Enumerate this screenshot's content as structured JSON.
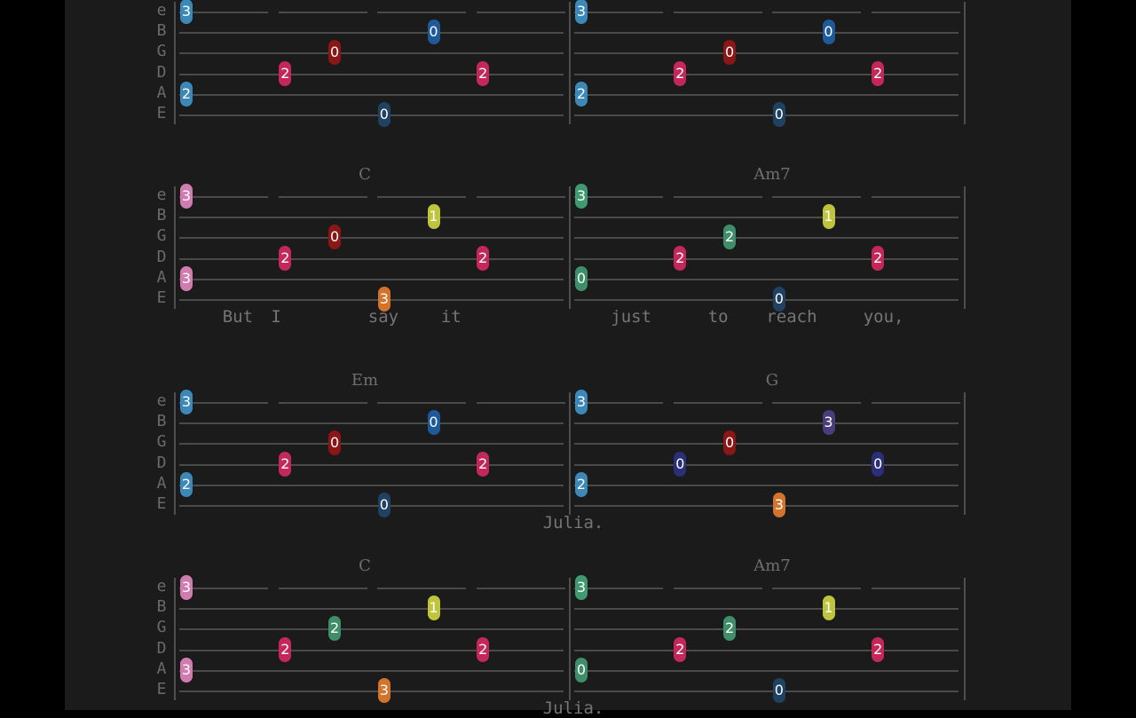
{
  "strings": [
    "e",
    "B",
    "G",
    "D",
    "A",
    "E"
  ],
  "colors": {
    "fret0_blue": "#1e5a9a",
    "fret0_navy": "#204262",
    "fret0_indigo": "#2a2f78",
    "fret0_red": "#8a1616",
    "fret0_green": "#3f8e6a",
    "fret1": "#bec53c",
    "fret2_red": "#c4285a",
    "fret2_teal": "#3f8e6a",
    "fret2_blue": "#3c88b8",
    "fret3_pink": "#d07cb0",
    "fret3_green": "#3f9a70",
    "fret3_blue": "#3c88b8",
    "fret3_orange": "#d2742c",
    "fret3_purple": "#4c3c7c"
  },
  "systems": [
    {
      "chords": [
        "",
        ""
      ],
      "lyrics": [],
      "measures": [
        [
          {
            "s": "e",
            "f": "3",
            "pos": 0,
            "c": "fret3_blue"
          },
          {
            "s": "A",
            "f": "2",
            "pos": 0,
            "c": "fret2_blue"
          },
          {
            "s": "D",
            "f": "2",
            "pos": 2,
            "c": "fret2_red"
          },
          {
            "s": "G",
            "f": "0",
            "pos": 3,
            "c": "fret0_red"
          },
          {
            "s": "E",
            "f": "0",
            "pos": 4,
            "c": "fret0_navy"
          },
          {
            "s": "B",
            "f": "0",
            "pos": 5,
            "c": "fret0_blue"
          },
          {
            "s": "D",
            "f": "2",
            "pos": 6,
            "c": "fret2_red"
          }
        ],
        [
          {
            "s": "e",
            "f": "3",
            "pos": 0,
            "c": "fret3_blue"
          },
          {
            "s": "A",
            "f": "2",
            "pos": 0,
            "c": "fret2_blue"
          },
          {
            "s": "D",
            "f": "2",
            "pos": 2,
            "c": "fret2_red"
          },
          {
            "s": "G",
            "f": "0",
            "pos": 3,
            "c": "fret0_red"
          },
          {
            "s": "E",
            "f": "0",
            "pos": 4,
            "c": "fret0_navy"
          },
          {
            "s": "B",
            "f": "0",
            "pos": 5,
            "c": "fret0_blue"
          },
          {
            "s": "D",
            "f": "2",
            "pos": 6,
            "c": "fret2_red"
          }
        ]
      ]
    },
    {
      "chords": [
        "C",
        "Am7"
      ],
      "lyrics": [
        {
          "text": "But",
          "pos": 1
        },
        {
          "text": "I",
          "pos": 2
        },
        {
          "text": "say",
          "pos": 4
        },
        {
          "text": "it",
          "pos": 5.5
        },
        {
          "text": "just",
          "pos": 9
        },
        {
          "text": "to",
          "pos": 11
        },
        {
          "text": "reach",
          "pos": 12.2
        },
        {
          "text": "you,",
          "pos": 14.2
        }
      ],
      "measures": [
        [
          {
            "s": "e",
            "f": "3",
            "pos": 0,
            "c": "fret3_pink"
          },
          {
            "s": "A",
            "f": "3",
            "pos": 0,
            "c": "fret3_pink"
          },
          {
            "s": "D",
            "f": "2",
            "pos": 2,
            "c": "fret2_red"
          },
          {
            "s": "G",
            "f": "0",
            "pos": 3,
            "c": "fret0_red"
          },
          {
            "s": "E",
            "f": "3",
            "pos": 4,
            "c": "fret3_orange"
          },
          {
            "s": "B",
            "f": "1",
            "pos": 5,
            "c": "fret1"
          },
          {
            "s": "D",
            "f": "2",
            "pos": 6,
            "c": "fret2_red"
          }
        ],
        [
          {
            "s": "e",
            "f": "3",
            "pos": 0,
            "c": "fret3_green"
          },
          {
            "s": "A",
            "f": "0",
            "pos": 0,
            "c": "fret0_green"
          },
          {
            "s": "D",
            "f": "2",
            "pos": 2,
            "c": "fret2_red"
          },
          {
            "s": "G",
            "f": "2",
            "pos": 3,
            "c": "fret2_teal"
          },
          {
            "s": "E",
            "f": "0",
            "pos": 4,
            "c": "fret0_navy"
          },
          {
            "s": "B",
            "f": "1",
            "pos": 5,
            "c": "fret1"
          },
          {
            "s": "D",
            "f": "2",
            "pos": 6,
            "c": "fret2_red"
          }
        ]
      ]
    },
    {
      "chords": [
        "Em",
        "G"
      ],
      "lyrics": [
        {
          "text": "Julia.",
          "pos": 7.6
        }
      ],
      "measures": [
        [
          {
            "s": "e",
            "f": "3",
            "pos": 0,
            "c": "fret3_blue"
          },
          {
            "s": "A",
            "f": "2",
            "pos": 0,
            "c": "fret2_blue"
          },
          {
            "s": "D",
            "f": "2",
            "pos": 2,
            "c": "fret2_red"
          },
          {
            "s": "G",
            "f": "0",
            "pos": 3,
            "c": "fret0_red"
          },
          {
            "s": "E",
            "f": "0",
            "pos": 4,
            "c": "fret0_navy"
          },
          {
            "s": "B",
            "f": "0",
            "pos": 5,
            "c": "fret0_blue"
          },
          {
            "s": "D",
            "f": "2",
            "pos": 6,
            "c": "fret2_red"
          }
        ],
        [
          {
            "s": "e",
            "f": "3",
            "pos": 0,
            "c": "fret3_blue"
          },
          {
            "s": "A",
            "f": "2",
            "pos": 0,
            "c": "fret2_blue"
          },
          {
            "s": "D",
            "f": "0",
            "pos": 2,
            "c": "fret0_indigo"
          },
          {
            "s": "G",
            "f": "0",
            "pos": 3,
            "c": "fret0_red"
          },
          {
            "s": "E",
            "f": "3",
            "pos": 4,
            "c": "fret3_orange"
          },
          {
            "s": "B",
            "f": "3",
            "pos": 5,
            "c": "fret3_purple"
          },
          {
            "s": "D",
            "f": "0",
            "pos": 6,
            "c": "fret0_indigo"
          }
        ]
      ]
    },
    {
      "chords": [
        "C",
        "Am7"
      ],
      "lyrics": [
        {
          "text": "Julia.",
          "pos": 7.6
        }
      ],
      "measures": [
        [
          {
            "s": "e",
            "f": "3",
            "pos": 0,
            "c": "fret3_pink"
          },
          {
            "s": "A",
            "f": "3",
            "pos": 0,
            "c": "fret3_pink"
          },
          {
            "s": "D",
            "f": "2",
            "pos": 2,
            "c": "fret2_red"
          },
          {
            "s": "G",
            "f": "2",
            "pos": 3,
            "c": "fret2_teal"
          },
          {
            "s": "E",
            "f": "3",
            "pos": 4,
            "c": "fret3_orange"
          },
          {
            "s": "B",
            "f": "1",
            "pos": 5,
            "c": "fret1"
          },
          {
            "s": "D",
            "f": "2",
            "pos": 6,
            "c": "fret2_red"
          }
        ],
        [
          {
            "s": "e",
            "f": "3",
            "pos": 0,
            "c": "fret3_green"
          },
          {
            "s": "A",
            "f": "0",
            "pos": 0,
            "c": "fret0_green"
          },
          {
            "s": "D",
            "f": "2",
            "pos": 2,
            "c": "fret2_red"
          },
          {
            "s": "G",
            "f": "2",
            "pos": 3,
            "c": "fret2_teal"
          },
          {
            "s": "E",
            "f": "0",
            "pos": 4,
            "c": "fret0_navy"
          },
          {
            "s": "B",
            "f": "1",
            "pos": 5,
            "c": "fret1"
          },
          {
            "s": "D",
            "f": "2",
            "pos": 6,
            "c": "fret2_red"
          }
        ]
      ]
    }
  ]
}
